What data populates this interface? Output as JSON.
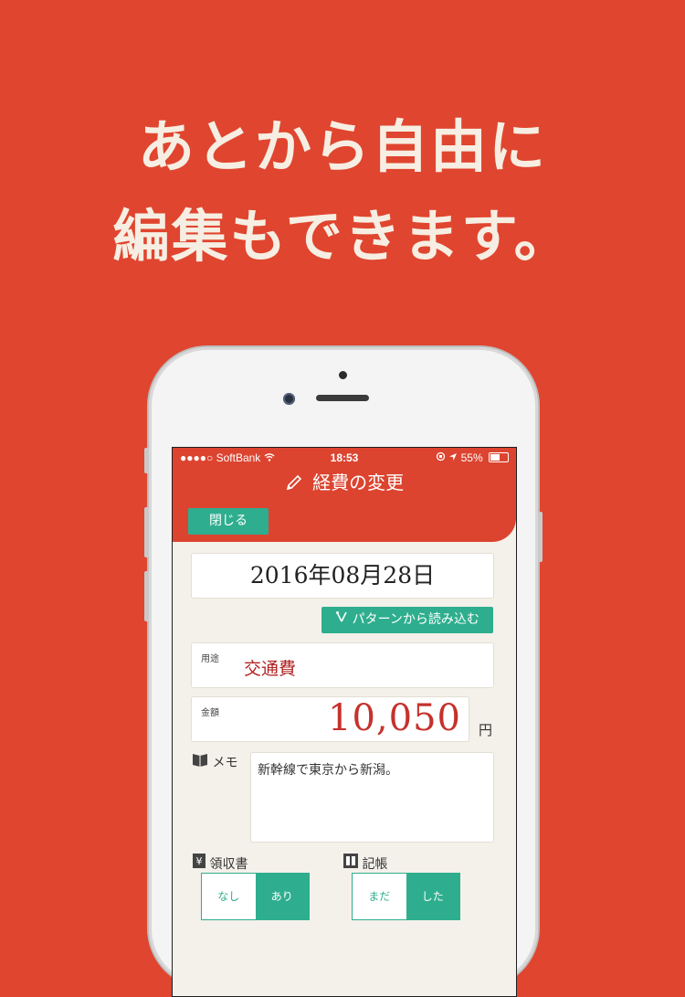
{
  "headline": {
    "line1": "あとから自由に",
    "line2": "編集もできます。"
  },
  "status_bar": {
    "signal": "●●●●○",
    "carrier": "SoftBank",
    "time": "18:53",
    "battery": "55%"
  },
  "header": {
    "title": "経費の変更",
    "close_button": "閉じる"
  },
  "form": {
    "date": "2016年08月28日",
    "pattern_button": "パターンから読み込む",
    "usage_label": "用途",
    "usage_value": "交通費",
    "amount_label": "金額",
    "amount_value": "10,050",
    "amount_unit": "円",
    "memo_label": "メモ",
    "memo_text": "新幹線で東京から新潟。",
    "receipt_label": "領収書",
    "receipt_options": [
      "なし",
      "あり"
    ],
    "receipt_selected": "あり",
    "record_label": "記帳",
    "record_options": [
      "まだ",
      "した"
    ],
    "record_selected": "した"
  },
  "colors": {
    "background": "#E0452F",
    "accent_green": "#2EAE8E",
    "header_red": "#DC4430",
    "amount_red": "#C5322C"
  }
}
